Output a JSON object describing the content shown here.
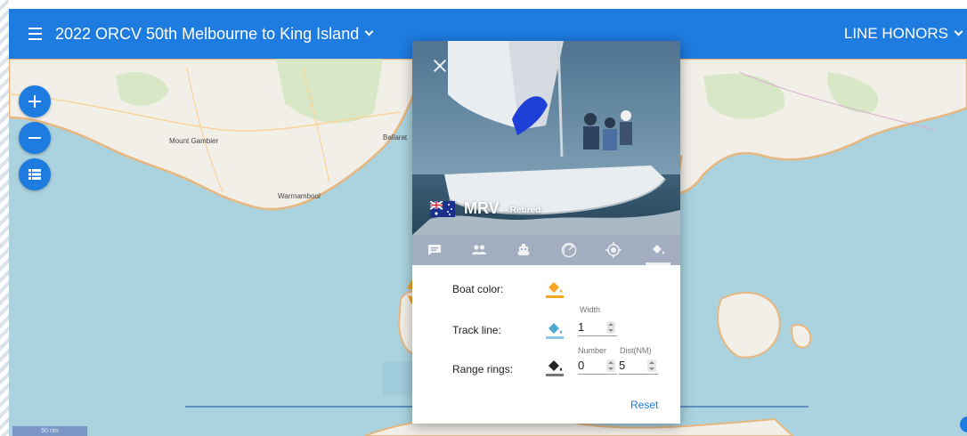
{
  "header": {
    "race_title": "2022 ORCV 50th Melbourne to King Island",
    "right_menu": "LINE HONORS"
  },
  "map": {
    "labels": {
      "mount_gambier": "Mount Gambier",
      "ballarat": "Ballarat",
      "warrnambool": "Warrnambool"
    },
    "scale": "50 nm",
    "colors": {
      "water": "#aad3df",
      "land": "#f2efe9",
      "park": "#cde6b7",
      "coast": "#e7b77f"
    }
  },
  "controls": {
    "zoom_in_icon": "plus-icon",
    "zoom_out_icon": "minus-icon",
    "list_icon": "list-icon"
  },
  "popup": {
    "boat_name": "MRV",
    "status": "- Retired",
    "flag": "australia-flag",
    "tabs": [
      "chat-icon",
      "crew-icon",
      "boat-icon",
      "speed-icon",
      "location-icon",
      "paint-bucket-icon"
    ],
    "active_tab": 5,
    "settings": {
      "boat_color_label": "Boat color:",
      "boat_color": "#f5a623",
      "track_line_label": "Track line:",
      "track_line_color": "#8ecae6",
      "width_label": "Width",
      "width_value": "1",
      "range_rings_label": "Range rings:",
      "range_rings_color": "#222222",
      "number_label": "Number",
      "number_value": "0",
      "dist_label": "Dist(NM)",
      "dist_value": "5",
      "reset_label": "Reset"
    }
  }
}
